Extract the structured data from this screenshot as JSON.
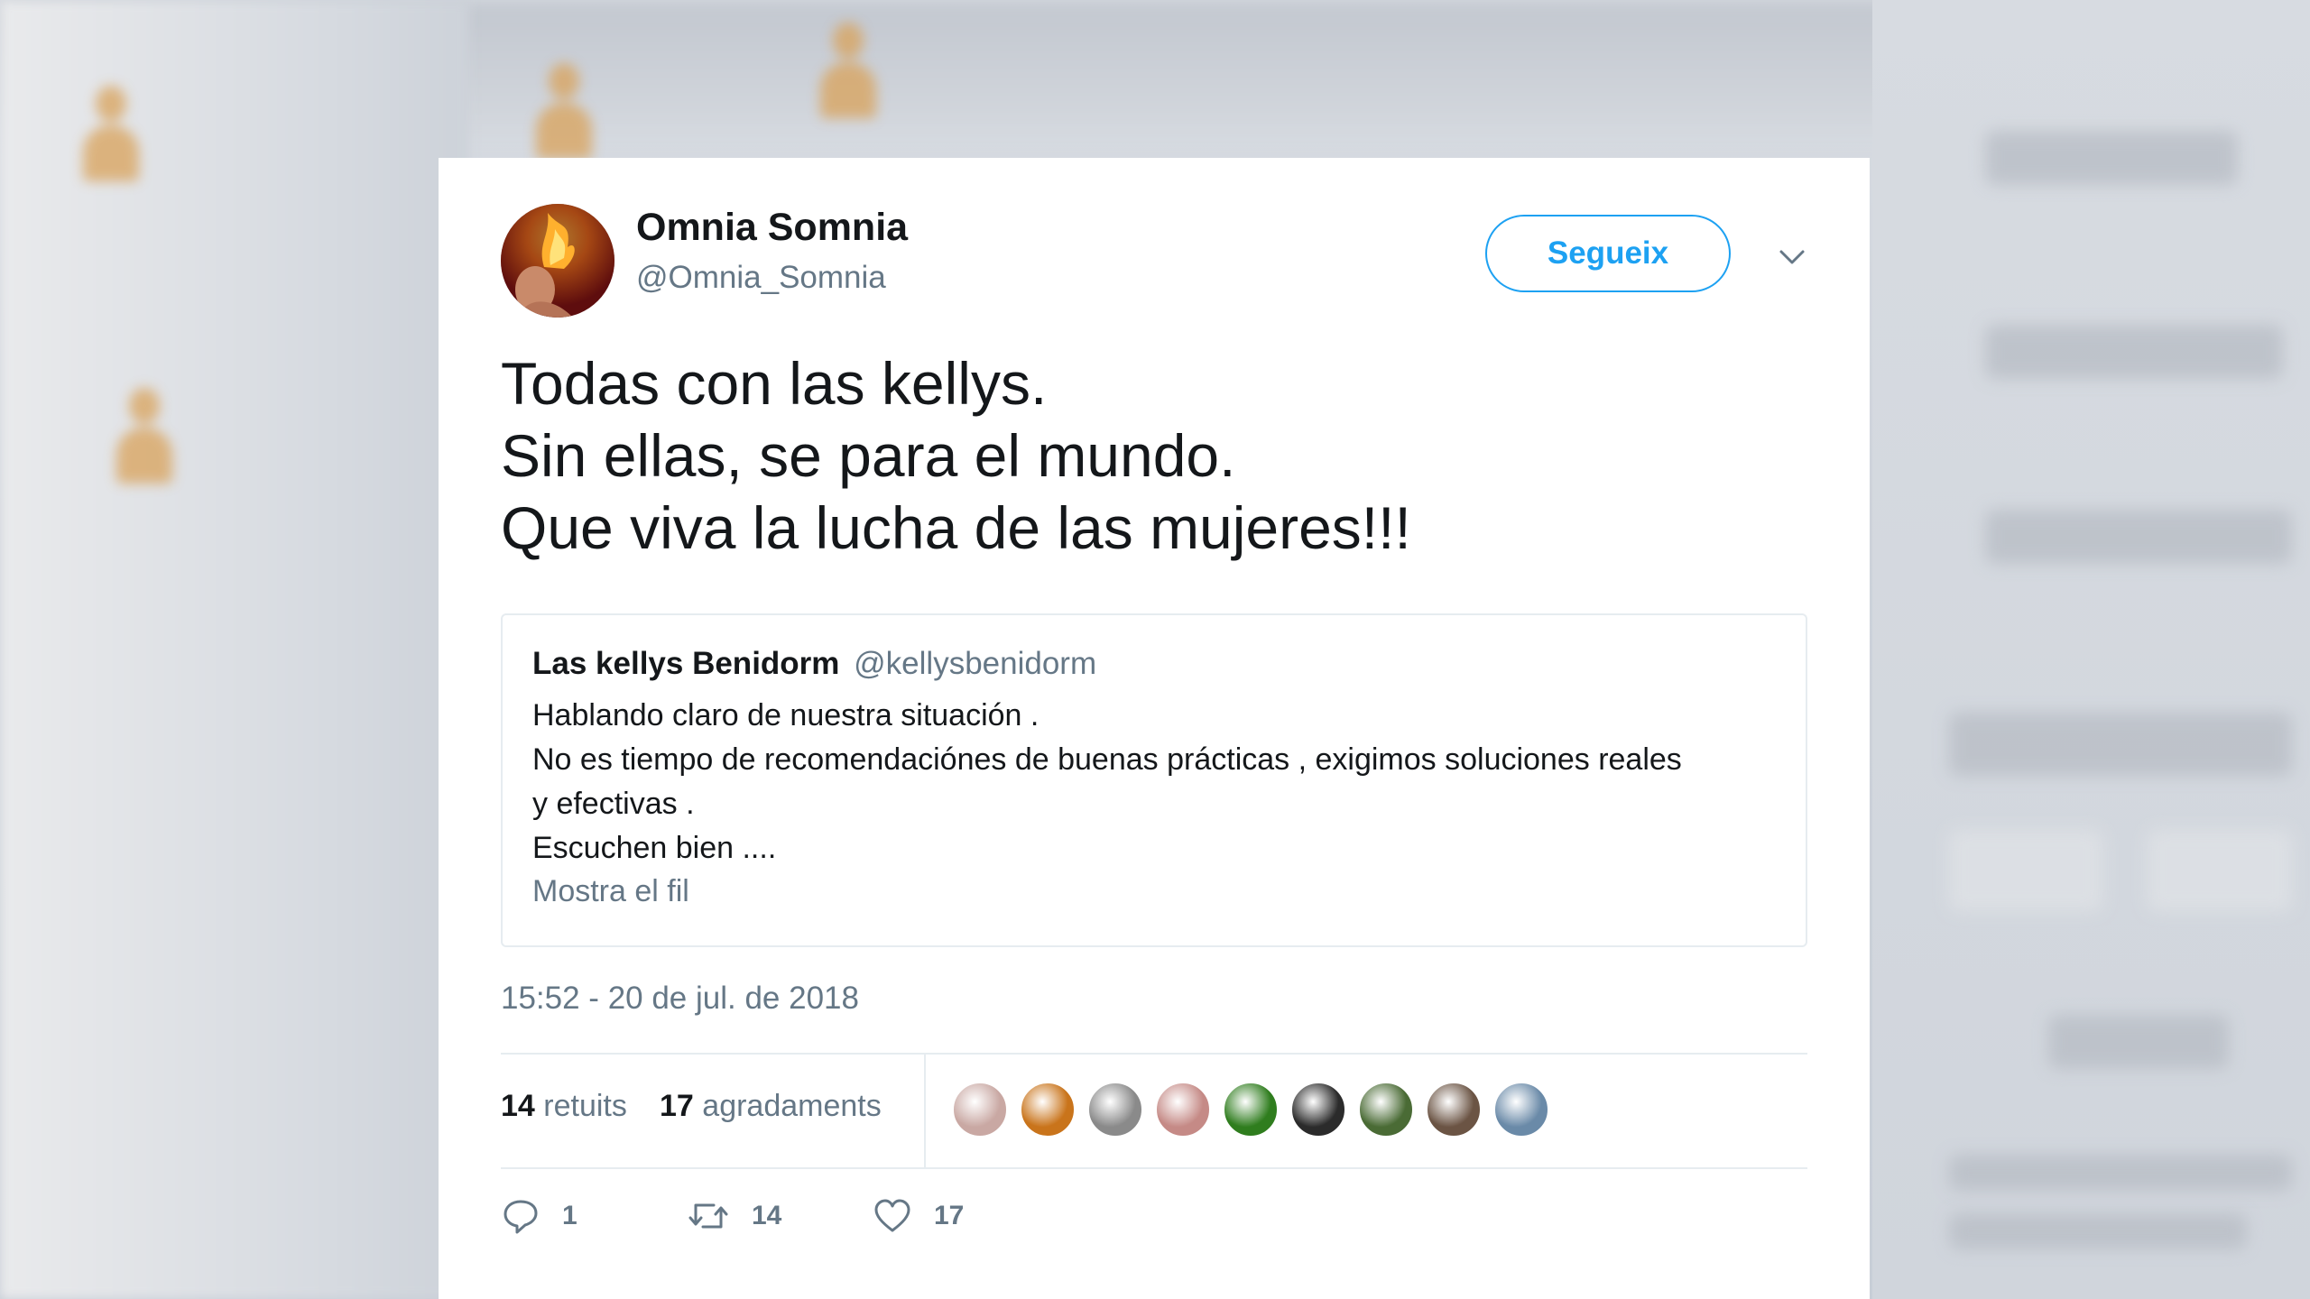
{
  "tweet": {
    "author": {
      "name": "Omnia Somnia",
      "handle": "@Omnia_Somnia"
    },
    "follow_label": "Segueix",
    "text_lines": [
      "Todas con las kellys.",
      "Sin ellas, se para el mundo.",
      "Que viva la lucha de las mujeres!!!"
    ],
    "quoted": {
      "name": "Las kellys Benidorm",
      "handle": "@kellysbenidorm",
      "lines": [
        "Hablando claro de nuestra situación .",
        "No es tiempo de recomendaciónes de buenas prácticas , exigimos soluciones reales",
        "y efectivas .",
        "Escuchen bien ...."
      ],
      "show_thread": "Mostra el fil"
    },
    "timestamp": "15:52 - 20 de jul. de 2018",
    "stats": {
      "retweets_count": "14",
      "retweets_label": "retuits",
      "likes_count": "17",
      "likes_label": "agradaments"
    },
    "liker_colors": [
      "#c9a8a3",
      "#c9741b",
      "#8a8a8a",
      "#c58a86",
      "#2f7d1e",
      "#2b2b2b",
      "#4a6b35",
      "#6b5444",
      "#6a8aa8"
    ],
    "actions": {
      "replies": "1",
      "retweets": "14",
      "likes": "17"
    }
  },
  "colors": {
    "accent": "#1da1f2",
    "text": "#14171a",
    "muted": "#657786",
    "border": "#e6ecf0"
  }
}
